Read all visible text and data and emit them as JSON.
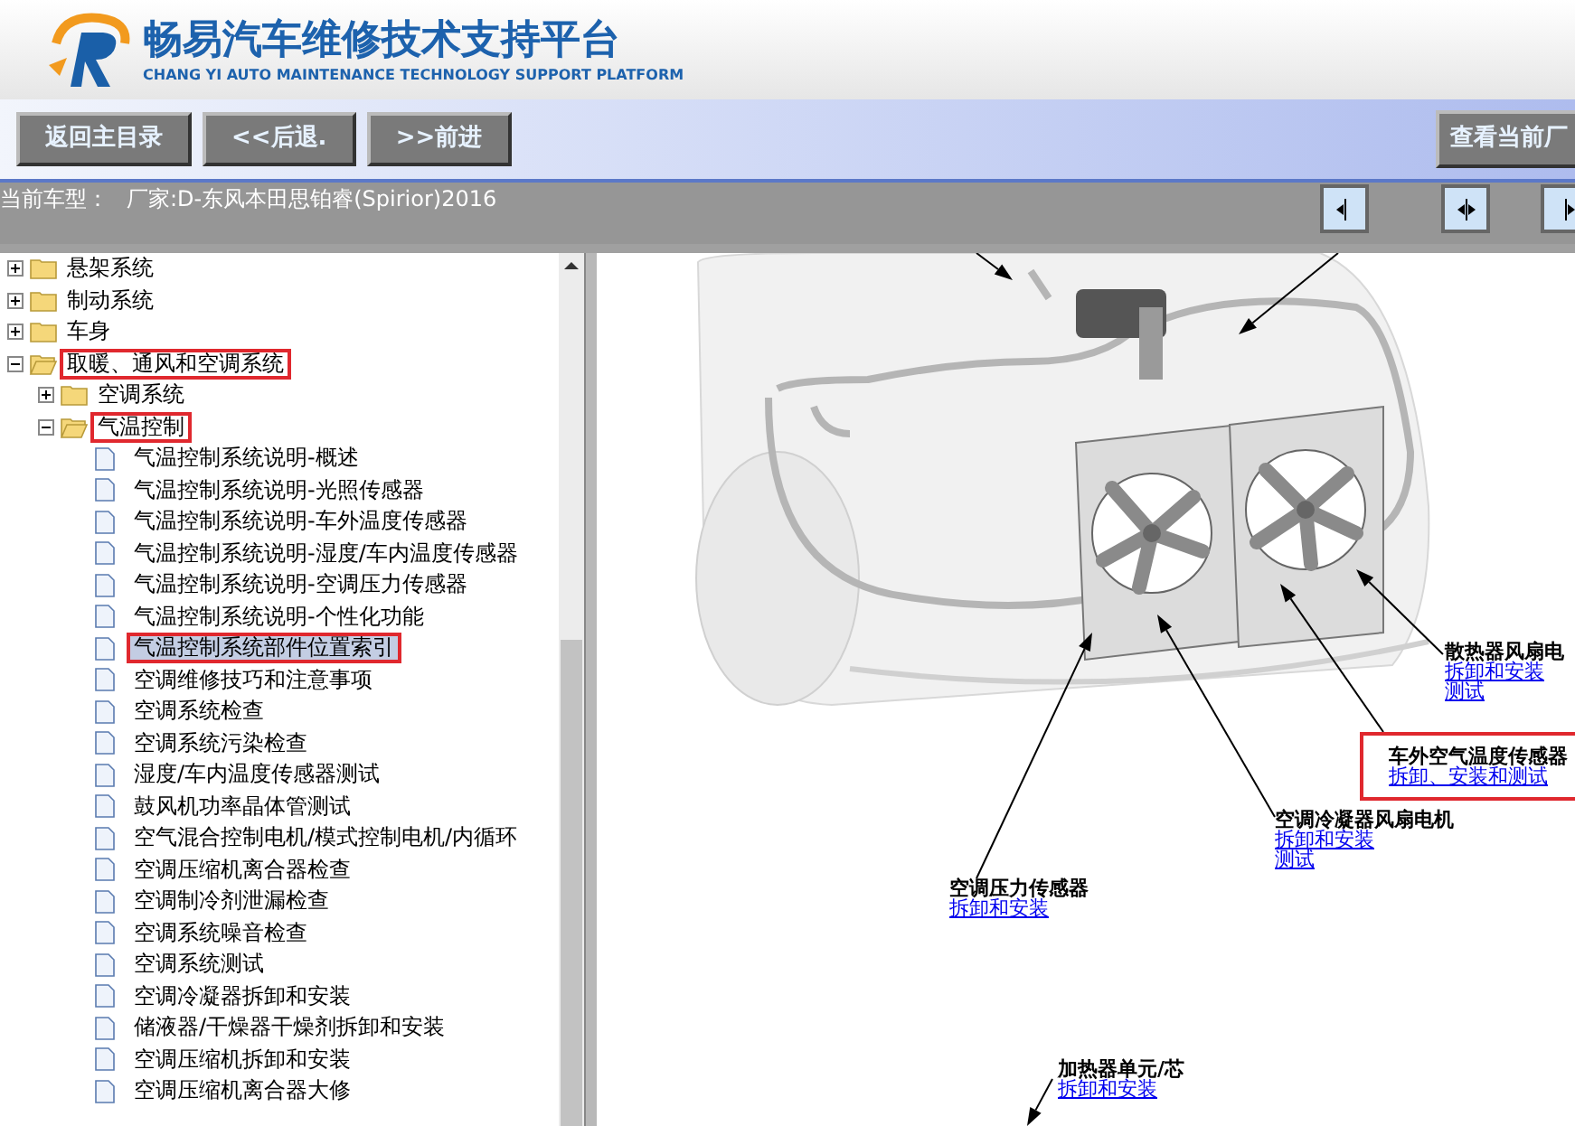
{
  "header": {
    "title": "畅易汽车维修技术支持平台",
    "subtitle": "CHANG YI AUTO MAINTENANCE TECHNOLOGY SUPPORT PLATFORM"
  },
  "toolbar": {
    "buttons": [
      "返回主目录",
      "<<后退.",
      ">>前进"
    ],
    "right_button": "查看当前厂"
  },
  "info_bar": {
    "current_model_label": "当前车型：",
    "current_model": "厂家:D-东风本田思铂睿(Spirior)2016"
  },
  "tree": [
    {
      "label": "悬架系统",
      "kind": "folder",
      "expanded": false,
      "highlighted": false
    },
    {
      "label": "制动系统",
      "kind": "folder",
      "expanded": false,
      "highlighted": false
    },
    {
      "label": "车身",
      "kind": "folder",
      "expanded": false,
      "highlighted": false
    },
    {
      "label": "取暖、通风和空调系统",
      "kind": "folder",
      "expanded": true,
      "highlighted": true,
      "children": [
        {
          "label": "空调系统",
          "kind": "folder",
          "expanded": false,
          "highlighted": false
        },
        {
          "label": "气温控制",
          "kind": "folder",
          "expanded": true,
          "highlighted": true,
          "children": [
            {
              "label": "气温控制系统说明-概述",
              "kind": "page",
              "selected": false,
              "highlighted": false
            },
            {
              "label": "气温控制系统说明-光照传感器",
              "kind": "page",
              "selected": false,
              "highlighted": false
            },
            {
              "label": "气温控制系统说明-车外温度传感器",
              "kind": "page",
              "selected": false,
              "highlighted": false
            },
            {
              "label": "气温控制系统说明-湿度/车内温度传感器",
              "kind": "page",
              "selected": false,
              "highlighted": false
            },
            {
              "label": "气温控制系统说明-空调压力传感器",
              "kind": "page",
              "selected": false,
              "highlighted": false
            },
            {
              "label": "气温控制系统说明-个性化功能",
              "kind": "page",
              "selected": false,
              "highlighted": false
            },
            {
              "label": "气温控制系统部件位置索引",
              "kind": "page",
              "selected": true,
              "highlighted": true
            },
            {
              "label": "空调维修技巧和注意事项",
              "kind": "page",
              "selected": false,
              "highlighted": false
            },
            {
              "label": "空调系统检查",
              "kind": "page",
              "selected": false,
              "highlighted": false
            },
            {
              "label": "空调系统污染检查",
              "kind": "page",
              "selected": false,
              "highlighted": false
            },
            {
              "label": "湿度/车内温度传感器测试",
              "kind": "page",
              "selected": false,
              "highlighted": false
            },
            {
              "label": "鼓风机功率晶体管测试",
              "kind": "page",
              "selected": false,
              "highlighted": false
            },
            {
              "label": "空气混合控制电机/模式控制电机/内循环",
              "kind": "page",
              "selected": false,
              "highlighted": false
            },
            {
              "label": "空调压缩机离合器检查",
              "kind": "page",
              "selected": false,
              "highlighted": false
            },
            {
              "label": "空调制冷剂泄漏检查",
              "kind": "page",
              "selected": false,
              "highlighted": false
            },
            {
              "label": "空调系统噪音检查",
              "kind": "page",
              "selected": false,
              "highlighted": false
            },
            {
              "label": "空调系统测试",
              "kind": "page",
              "selected": false,
              "highlighted": false
            },
            {
              "label": "空调冷凝器拆卸和安装",
              "kind": "page",
              "selected": false,
              "highlighted": false
            },
            {
              "label": "储液器/干燥器干燥剂拆卸和安装",
              "kind": "page",
              "selected": false,
              "highlighted": false
            },
            {
              "label": "空调压缩机拆卸和安装",
              "kind": "page",
              "selected": false,
              "highlighted": false
            },
            {
              "label": "空调压缩机离合器大修",
              "kind": "page",
              "selected": false,
              "highlighted": false
            }
          ]
        }
      ]
    }
  ],
  "diagram_labels": [
    {
      "title": "散热器风扇电",
      "links": [
        "拆卸和安装",
        "测试"
      ],
      "highlighted": false
    },
    {
      "title": "车外空气温度传感器",
      "links": [
        "拆卸、安装和测试"
      ],
      "highlighted": true
    },
    {
      "title": "空调冷凝器风扇电机",
      "links": [
        "拆卸和安装",
        "测试"
      ],
      "highlighted": false
    },
    {
      "title": "空调压力传感器",
      "links": [
        "拆卸和安装"
      ],
      "highlighted": false
    },
    {
      "title": "加热器单元/芯",
      "links": [
        "拆卸和安装"
      ],
      "highlighted": false
    }
  ]
}
